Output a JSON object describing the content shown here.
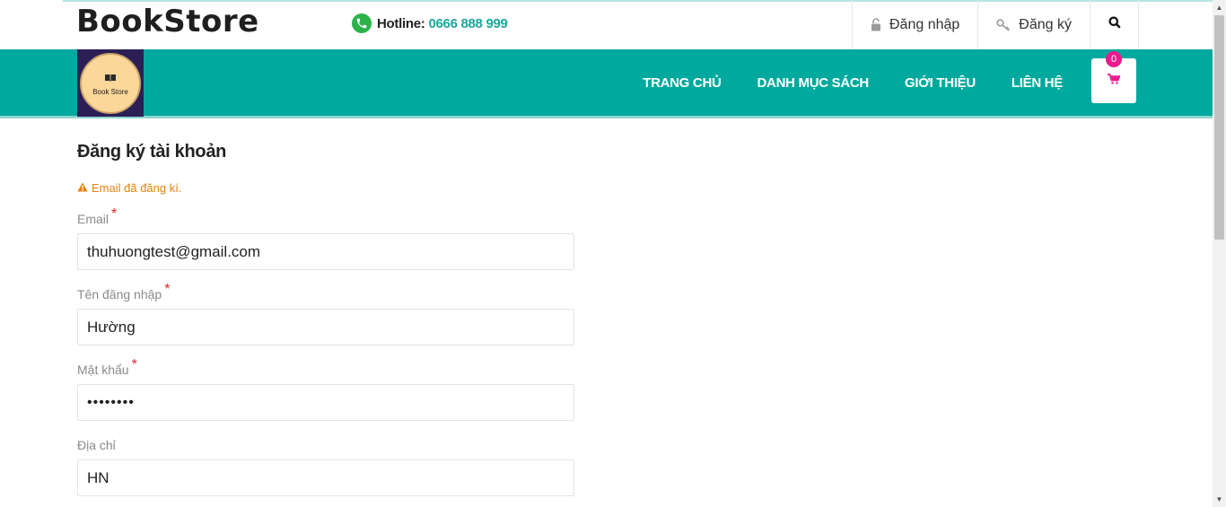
{
  "header": {
    "brand": "BookStore",
    "hotline_label": "Hotline:",
    "hotline_number": "0666 888 999",
    "login_label": "Đăng nhập",
    "register_label": "Đăng ký"
  },
  "logo": {
    "text": "Book Store"
  },
  "nav": {
    "items": [
      {
        "label": "TRANG CHỦ"
      },
      {
        "label": "DANH MỤC SÁCH"
      },
      {
        "label": "GIỚI THIỆU"
      },
      {
        "label": "LIÊN HỆ"
      }
    ],
    "cart_count": "0"
  },
  "form": {
    "title": "Đăng ký tài khoản",
    "alert": "Email đã đăng kí.",
    "email_label": "Email",
    "email_value": "thuhuongtest@gmail.com",
    "username_label": "Tên đăng nhập",
    "username_value": "Hường",
    "password_label": "Mật khẩu",
    "password_value": "••••••••",
    "address_label": "Địa chỉ",
    "address_value": "HN",
    "required_mark": "*"
  },
  "colors": {
    "primary": "#00a99d",
    "cart_badge": "#ea1a8e",
    "warning": "#e3830e",
    "required": "#e02424"
  }
}
